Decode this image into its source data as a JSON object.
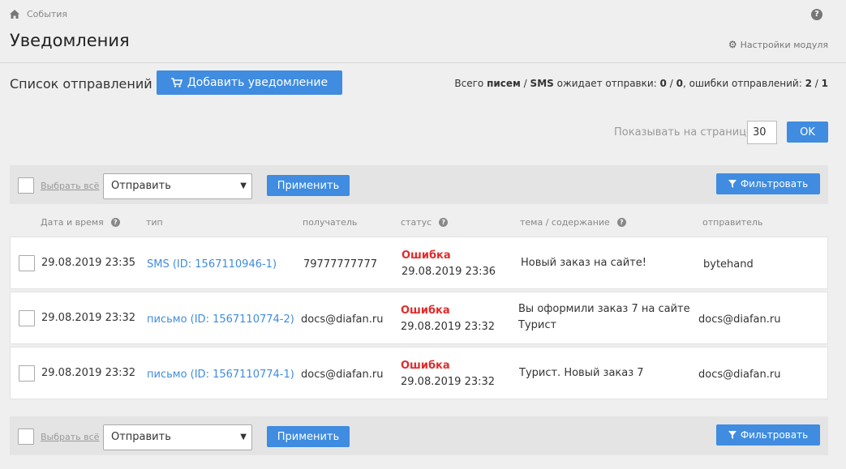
{
  "breadcrumb": {
    "label": "События"
  },
  "page": {
    "title": "Уведомления",
    "settings_label": "Настройки модуля"
  },
  "list": {
    "title": "Список отправлений",
    "add_button": "Добавить уведомление",
    "summary": {
      "prefix": "Всего",
      "letters": "писем",
      "sep": "/",
      "sms": "SMS",
      "waiting_text": "ожидает отправки:",
      "waiting_letters": "0",
      "waiting_sms": "0",
      "errors_text": ", ошибки отправлений:",
      "errors_letters": "2",
      "errors_sms": "1"
    }
  },
  "pagination": {
    "label": "Показывать на странице:",
    "value": "30",
    "ok_label": "OK"
  },
  "toolbar": {
    "select_all": "Выбрать всё",
    "action_selected": "Отправить",
    "apply_label": "Применить",
    "filter_label": "Фильтровать"
  },
  "columns": {
    "date": "Дата и время",
    "type": "тип",
    "recipient": "получатель",
    "status": "статус",
    "subject": "тема / содержание",
    "sender": "отправитель"
  },
  "rows": [
    {
      "date": "29.08.2019 23:35",
      "type": "SMS (ID: 1567110946-1)",
      "recipient": "79777777777",
      "status": "Ошибка",
      "status_date": "29.08.2019 23:36",
      "subject_line1": "Новый заказ на сайте!",
      "subject_line2": "",
      "sender": "bytehand"
    },
    {
      "date": "29.08.2019 23:32",
      "type": "письмо (ID: 1567110774-2)",
      "recipient": "docs@diafan.ru",
      "status": "Ошибка",
      "status_date": "29.08.2019 23:32",
      "subject_line1": "Вы оформили заказ 7 на сайте",
      "subject_line2": "Турист",
      "sender": "docs@diafan.ru"
    },
    {
      "date": "29.08.2019 23:32",
      "type": "письмо (ID: 1567110774-1)",
      "recipient": "docs@diafan.ru",
      "status": "Ошибка",
      "status_date": "29.08.2019 23:32",
      "subject_line1": "Турист. Новый заказ 7",
      "subject_line2": "",
      "sender": "docs@diafan.ru"
    }
  ],
  "colors": {
    "accent": "#3f8ce0",
    "error": "#e12b2b",
    "background": "#efefef"
  },
  "icons": {
    "breadcrumb": "home-icon",
    "help": "help-icon",
    "settings": "gear-icon",
    "add": "cart-icon",
    "filter": "filter-icon",
    "column_help": "question-icon",
    "select": "caret-down-icon"
  }
}
